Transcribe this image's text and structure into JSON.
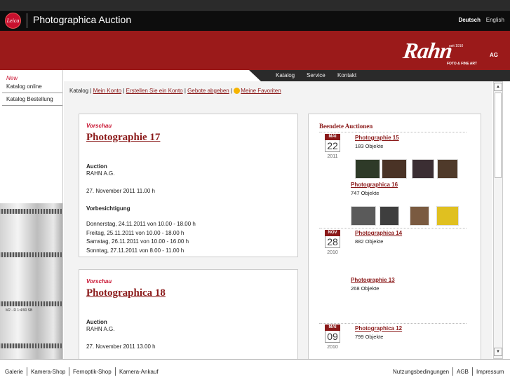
{
  "header": {
    "logo_text": "Leica",
    "title": "Photographica Auction",
    "lang_active": "Deutsch",
    "lang_other": "English"
  },
  "banner": {
    "brand": "Rahn",
    "brand_suffix": "AG",
    "since": "seit 1910",
    "tagline": "FOTO & FINE ART",
    "bg_color": "#9b1a1a"
  },
  "nav": {
    "items": [
      "Katalog",
      "Service",
      "Kontakt"
    ]
  },
  "sidebar": {
    "new_label": "New",
    "items": [
      "Katalog online",
      "Katalog Bestellung"
    ],
    "lens_text": "M2 - R 1:4/90 SB"
  },
  "breadcrumb": {
    "current": "Katalog",
    "links": [
      "Mein Konto",
      "Erstellen Sie ein Konto",
      "Gebote abgeben",
      "Meine Favoriten"
    ],
    "star_icon": "star-icon"
  },
  "cards": [
    {
      "pre": "Vorschau",
      "title": "Photographie 17",
      "auction_label": "Auction",
      "auction_house": "RAHN A.G.",
      "date": "27. November 2011 11.00 h",
      "viewing_label": "Vorbesichtigung",
      "viewing": [
        "Donnerstag, 24.11.2011 von 10.00 - 18.00 h",
        "Freitag, 25.11.2011 von 10.00 - 18.00 h",
        "Samstag, 26.11.2011 von 10.00 - 16.00 h",
        "Sonntag, 27.11.2011 von 8.00 - 11.00 h"
      ]
    },
    {
      "pre": "Vorschau",
      "title": "Photographica 18",
      "auction_label": "Auction",
      "auction_house": "RAHN A.G.",
      "date": "27. November 2011 13.00 h"
    }
  ],
  "ended": {
    "heading": "Beendete Auctionen",
    "groups": [
      {
        "month": "MAI",
        "day": "22",
        "year": "2011"
      },
      {
        "month": "NOV",
        "day": "28",
        "year": "2010"
      },
      {
        "month": "MAI",
        "day": "09",
        "year": "2010"
      }
    ],
    "auctions": [
      {
        "title": "Photographie 15",
        "count": "183 Objekte"
      },
      {
        "title": "Photographica 16",
        "count": "747 Objekte"
      },
      {
        "title": "Photographica 14",
        "count": "882 Objekte"
      },
      {
        "title": "Photographie 13",
        "count": "268 Objekte"
      },
      {
        "title": "Photographica 12",
        "count": "799 Objekte"
      }
    ]
  },
  "footer": {
    "left": [
      "Galerie",
      "Kamera-Shop",
      "Fernoptik-Shop",
      "Kamera-Ankauf"
    ],
    "right": [
      "Nutzungsbedingungen",
      "AGB",
      "Impressum"
    ]
  },
  "colors": {
    "accent": "#8b1a1a",
    "red": "#c8102e",
    "nav": "#2a2a2a"
  }
}
